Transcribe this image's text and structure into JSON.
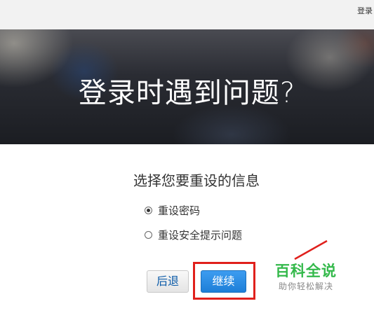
{
  "topbar": {
    "login_label": "登录"
  },
  "hero": {
    "title": "登录时遇到问题?"
  },
  "form": {
    "prompt": "选择您要重设的信息",
    "options": [
      {
        "label": "重设密码",
        "selected": true
      },
      {
        "label": "重设安全提示问题",
        "selected": false
      }
    ],
    "back_label": "后退",
    "continue_label": "继续"
  },
  "watermark": {
    "title": "百科全说",
    "subtitle": "助你轻松解决"
  },
  "colors": {
    "highlight": "#e0201c",
    "primary_button": "#2b8ce6",
    "watermark": "#34b94b"
  }
}
